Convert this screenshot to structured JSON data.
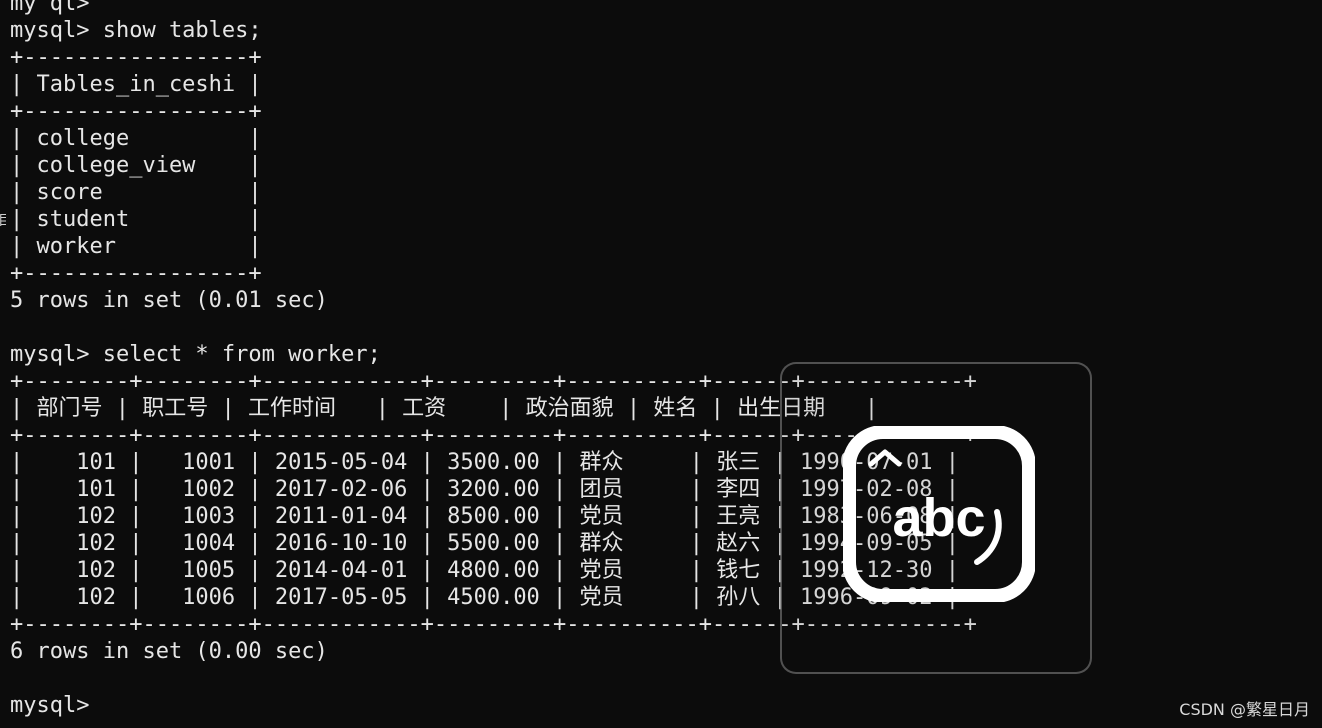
{
  "terminal": {
    "lines": [
      "my ql>",
      "mysql> show tables;",
      "+-----------------+",
      "| Tables_in_ceshi |",
      "+-----------------+",
      "| college         |",
      "| college_view    |",
      "| score           |",
      "| student         |",
      "| worker          |",
      "+-----------------+",
      "5 rows in set (0.01 sec)",
      "",
      "mysql> select * from worker;",
      "+--------+--------+------------+---------+----------+------+------------+",
      "| 部门号 | 职工号 | 工作时间   | 工资    | 政治面貌 | 姓名 | 出生日期   |",
      "+--------+--------+------------+---------+----------+------+------------+",
      "|    101 |   1001 | 2015-05-04 | 3500.00 | 群众     | 张三 | 1990-07-01 |",
      "|    101 |   1002 | 2017-02-06 | 3200.00 | 团员     | 李四 | 1997-02-08 |",
      "|    102 |   1003 | 2011-01-04 | 8500.00 | 党员     | 王亮 | 1983-06-08 |",
      "|    102 |   1004 | 2016-10-10 | 5500.00 | 群众     | 赵六 | 1994-09-05 |",
      "|    102 |   1005 | 2014-04-01 | 4800.00 | 党员     | 钱七 | 1992-12-30 |",
      "|    102 |   1006 | 2017-05-05 | 4500.00 | 党员     | 孙八 | 1996-09-02 |",
      "+--------+--------+------------+---------+----------+------+------------+",
      "6 rows in set (0.00 sec)",
      "",
      "mysql>"
    ]
  },
  "ime_indicator": {
    "icon": "ime-abc-icon",
    "text": "abc"
  },
  "left_edge_glyph": "目",
  "watermark": "CSDN @繁星日月",
  "colors": {
    "background": "#0c0c0c",
    "text": "#e6e6e6",
    "overlay_white": "#ffffff"
  }
}
